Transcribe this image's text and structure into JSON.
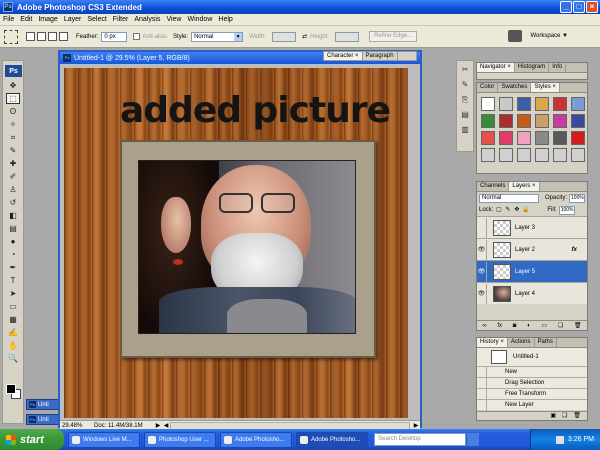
{
  "window": {
    "title": "Adobe Photoshop CS3 Extended",
    "icon_text": "Ps"
  },
  "menu": [
    "File",
    "Edit",
    "Image",
    "Layer",
    "Select",
    "Filter",
    "Analysis",
    "View",
    "Window",
    "Help"
  ],
  "options": {
    "feather_label": "Feather:",
    "feather_value": "0 px",
    "antialias_label": "Anti-alias",
    "style_label": "Style:",
    "style_value": "Normal",
    "width_label": "Width:",
    "height_label": "Height:",
    "refine_edge": "Refine Edge...",
    "workspace_label": "Workspace ▼"
  },
  "toolbox": {
    "logo": "Ps",
    "tools": [
      {
        "name": "move-tool-icon",
        "glyph": "✥"
      },
      {
        "name": "marquee-tool-icon",
        "glyph": "⬚",
        "selected": true
      },
      {
        "name": "lasso-tool-icon",
        "glyph": "ʘ"
      },
      {
        "name": "magic-wand-tool-icon",
        "glyph": "✧"
      },
      {
        "name": "crop-tool-icon",
        "glyph": "⌗"
      },
      {
        "name": "eyedropper-tool-icon",
        "glyph": "✎"
      },
      {
        "name": "healing-brush-tool-icon",
        "glyph": "✚"
      },
      {
        "name": "brush-tool-icon",
        "glyph": "✐"
      },
      {
        "name": "clone-stamp-tool-icon",
        "glyph": "♙"
      },
      {
        "name": "history-brush-tool-icon",
        "glyph": "↺"
      },
      {
        "name": "eraser-tool-icon",
        "glyph": "◧"
      },
      {
        "name": "gradient-tool-icon",
        "glyph": "▤"
      },
      {
        "name": "blur-tool-icon",
        "glyph": "●"
      },
      {
        "name": "dodge-tool-icon",
        "glyph": "◔"
      },
      {
        "name": "pen-tool-icon",
        "glyph": "✒"
      },
      {
        "name": "type-tool-icon",
        "glyph": "T"
      },
      {
        "name": "path-selection-tool-icon",
        "glyph": "➤"
      },
      {
        "name": "shape-tool-icon",
        "glyph": "▭"
      },
      {
        "name": "notes-tool-icon",
        "glyph": "▦"
      },
      {
        "name": "eyedropper2-tool-icon",
        "glyph": "✍"
      },
      {
        "name": "hand-tool-icon",
        "glyph": "✋"
      },
      {
        "name": "zoom-tool-icon",
        "glyph": "🔍"
      }
    ]
  },
  "minimized_docs": [
    {
      "label": "Unti"
    },
    {
      "label": "Unti"
    }
  ],
  "document": {
    "title": "Untitled-1 @ 29.5% (Layer 5, RGB/8)",
    "headline": "added picture",
    "zoom": "29.48%",
    "doc_size": "Doc: 11.4M/38.1M"
  },
  "character_panel": {
    "tabs": [
      "Character ×",
      "Paragraph"
    ]
  },
  "navigator_panel": {
    "tabs": [
      "Navigator ×",
      "Histogram",
      "Info"
    ]
  },
  "styles_panel": {
    "tabs": [
      "Color",
      "Swatches",
      "Styles ×"
    ],
    "swatches": [
      "#ffffff",
      "#c9c9c9",
      "#3a5ea8",
      "#d9a84a",
      "#cc3333",
      "#7a9cd6",
      "#3a8a3a",
      "#aa3030",
      "#c45c1c",
      "#c8a06a",
      "#c83ca0",
      "#3a4a9a",
      "#e25050",
      "#e23a6a",
      "#f0a0c0",
      "#8a8a8a",
      "#5a5a5a",
      "#d21e1e",
      "#d0d0d0",
      "#d0d0d0",
      "#d0d0d0",
      "#d0d0d0",
      "#d0d0d0",
      "#d0d0d0"
    ]
  },
  "layers_panel": {
    "tabs": [
      "Channels",
      "Layers ×"
    ],
    "blend_mode": "Normal",
    "opacity_label": "Opacity:",
    "opacity_value": "100%",
    "lock_label": "Lock:",
    "fill_label": "Fill:",
    "fill_value": "100%",
    "layers": [
      {
        "name": "Layer 3",
        "visible": false,
        "fx": false,
        "selected": false,
        "photo": false
      },
      {
        "name": "Layer 2",
        "visible": true,
        "fx": true,
        "selected": false,
        "photo": false
      },
      {
        "name": "Layer 5",
        "visible": true,
        "fx": false,
        "selected": true,
        "photo": false
      },
      {
        "name": "Layer 4",
        "visible": true,
        "fx": false,
        "selected": false,
        "photo": true
      }
    ],
    "fx_label": "fx"
  },
  "history_panel": {
    "tabs": [
      "History ×",
      "Actions",
      "Paths"
    ],
    "snapshot": "Untitled-1",
    "items": [
      "New",
      "Drag Selection",
      "Free Transform",
      "New Layer"
    ]
  },
  "taskbar": {
    "start": "start",
    "buttons": [
      "Windows Live M...",
      "Photoshop User ...",
      "Adobe Photosho...",
      "Adobe Photosho..."
    ],
    "active_index": 3,
    "search_placeholder": "Search Desktop",
    "clock": "3:26 PM"
  }
}
